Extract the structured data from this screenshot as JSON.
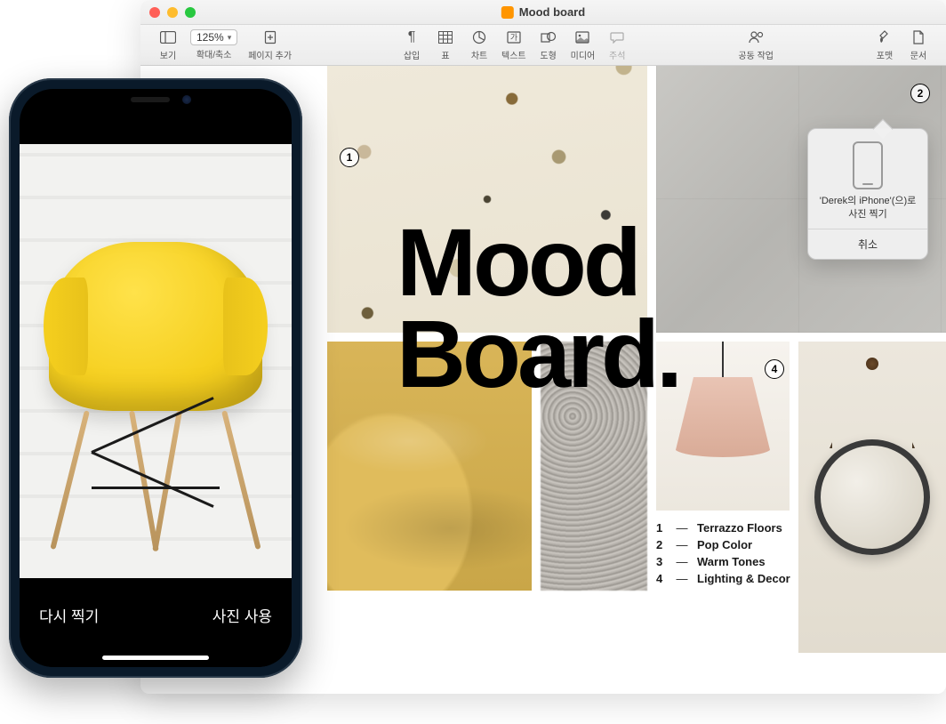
{
  "window": {
    "title": "Mood board"
  },
  "toolbar": {
    "view": "보기",
    "zoom_value": "125%",
    "zoom_label": "확대/축소",
    "add_page": "페이지 추가",
    "insert": "삽입",
    "table": "표",
    "chart": "차트",
    "text": "텍스트",
    "shape": "도형",
    "media": "미디어",
    "comment": "주석",
    "collaborate": "공동 작업",
    "format": "포맷",
    "document": "문서"
  },
  "document": {
    "heading_line1": "Mood",
    "heading_line2": "Board.",
    "callouts": {
      "c1": "1",
      "c2": "2",
      "c4": "4"
    },
    "legend": [
      {
        "num": "1",
        "label": "Terrazzo Floors"
      },
      {
        "num": "2",
        "label": "Pop Color"
      },
      {
        "num": "3",
        "label": "Warm Tones"
      },
      {
        "num": "4",
        "label": "Lighting & Decor"
      }
    ]
  },
  "popover": {
    "text_line1": "'Derek의 iPhone'(으)로",
    "text_line2": "사진 찍기",
    "cancel": "취소"
  },
  "iphone": {
    "retake": "다시 찍기",
    "use_photo": "사진 사용"
  }
}
